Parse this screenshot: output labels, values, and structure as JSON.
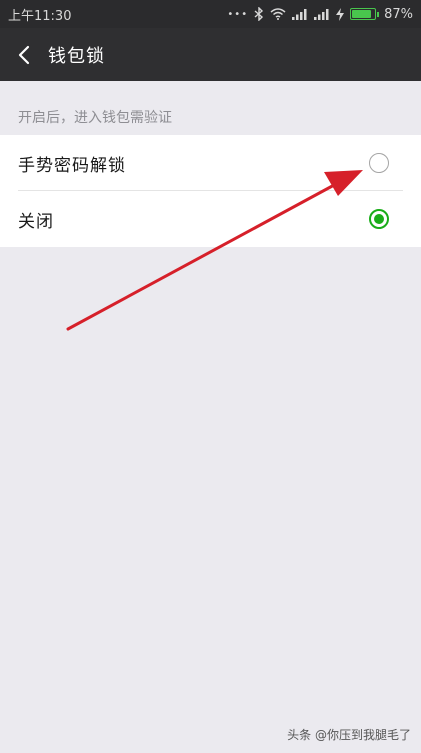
{
  "status_bar": {
    "time": "上午11:30",
    "dots": "•••",
    "battery_percent": "87%",
    "battery_level": 0.87,
    "icons": [
      "bluetooth-icon",
      "wifi-icon",
      "signal-icon",
      "signal-icon",
      "charging-icon",
      "battery-icon"
    ]
  },
  "header": {
    "back_icon": "chevron-left-icon",
    "title": "钱包锁"
  },
  "section": {
    "header": "开启后，进入钱包需验证"
  },
  "options": [
    {
      "label": "手势密码解锁",
      "selected": false
    },
    {
      "label": "关闭",
      "selected": true
    }
  ],
  "colors": {
    "accent": "#1aad19",
    "title_bar": "#2f2f31",
    "status_bar": "#2b2b2d",
    "background": "#ebeaef",
    "annotation": "#d6202a"
  },
  "watermark": "头条 @你压到我腿毛了"
}
